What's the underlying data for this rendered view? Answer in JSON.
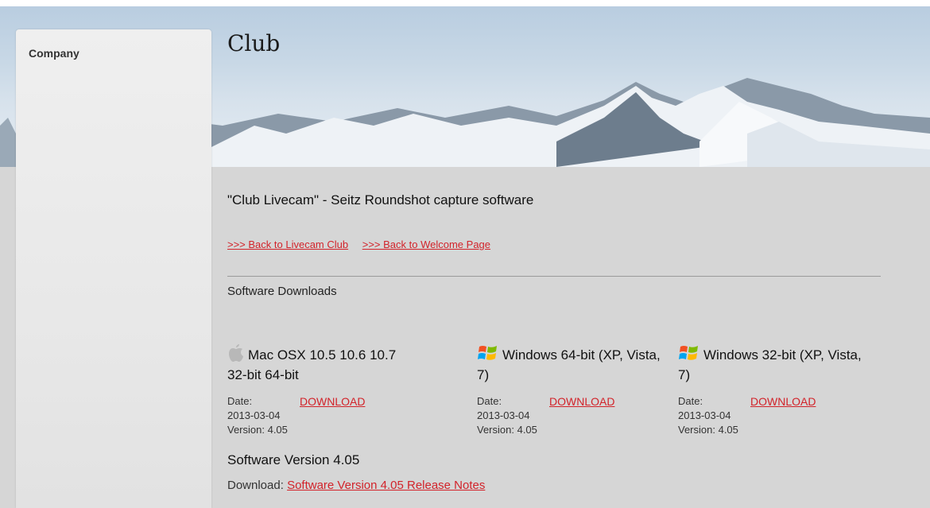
{
  "sidebar": {
    "title": "Company"
  },
  "header": {
    "page_title": "Club"
  },
  "main": {
    "heading": "\"Club Livecam\" - Seitz Roundshot capture software",
    "links": [
      ">>> Back to Livecam Club",
      ">>> Back to Welcome Page"
    ],
    "section_title": "Software Downloads",
    "downloads": [
      {
        "icon": "apple-icon",
        "title": "Mac OSX 10.5 10.6 10.7 32-bit 64-bit",
        "date_label": "Date:",
        "date": "2013-03-04",
        "version": "Version: 4.05",
        "download_label": "DOWNLOAD"
      },
      {
        "icon": "windows-icon",
        "title": "Windows 64-bit (XP, Vista, 7)",
        "date_label": "Date:",
        "date": "2013-03-04",
        "version": "Version: 4.05",
        "download_label": "DOWNLOAD"
      },
      {
        "icon": "windows-icon",
        "title": "Windows 32-bit (XP, Vista, 7)",
        "date_label": "Date:",
        "date": "2013-03-04",
        "version": "Version: 4.05",
        "download_label": "DOWNLOAD"
      }
    ],
    "version_title": "Software Version 4.05",
    "release_prefix": "Download:",
    "release_link": "Software Version 4.05 Release Notes"
  },
  "colors": {
    "link": "#d2232a",
    "background": "#d6d6d6",
    "sidebar": "#e8e8e8"
  }
}
